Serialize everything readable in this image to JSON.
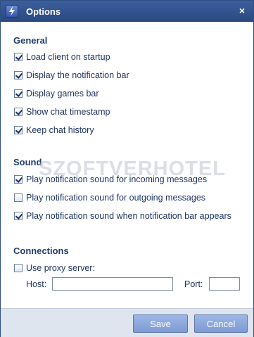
{
  "window": {
    "title": "Options",
    "close_label": "×"
  },
  "general": {
    "heading": "General",
    "options": [
      {
        "label": "Load client on startup",
        "checked": true
      },
      {
        "label": "Display the notification bar",
        "checked": true
      },
      {
        "label": "Display games bar",
        "checked": true
      },
      {
        "label": "Show chat timestamp",
        "checked": true
      },
      {
        "label": "Keep chat history",
        "checked": true
      }
    ]
  },
  "sound": {
    "heading": "Sound",
    "options": [
      {
        "label": "Play notification sound for incoming messages",
        "checked": true
      },
      {
        "label": "Play notification sound for outgoing messages",
        "checked": false
      },
      {
        "label": "Play notification sound when notification bar appears",
        "checked": true
      }
    ]
  },
  "connections": {
    "heading": "Connections",
    "use_proxy": {
      "label": "Use proxy server:",
      "checked": false
    },
    "host_label": "Host:",
    "host_value": "",
    "port_label": "Port:",
    "port_value": ""
  },
  "footer": {
    "save_label": "Save",
    "cancel_label": "Cancel"
  },
  "watermark": "SZOFTVERHOTEL"
}
